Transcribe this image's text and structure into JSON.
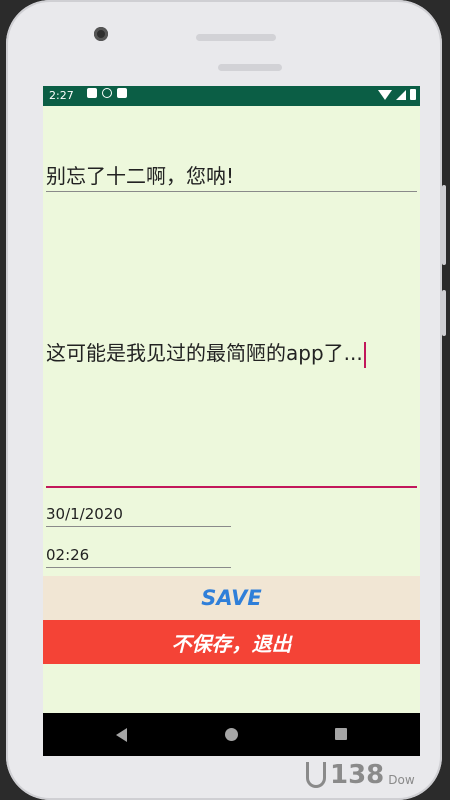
{
  "status_bar": {
    "time": "2:27",
    "left_icons": [
      "a-notification-icon",
      "sync-icon",
      "sd-card-icon"
    ],
    "right_icons": [
      "wifi-icon",
      "signal-icon",
      "battery-icon"
    ]
  },
  "note": {
    "title": "别忘了十二啊，您呐!",
    "content": "这可能是我见过的最简陋的app了...",
    "date": "30/1/2020",
    "time": "02:26"
  },
  "buttons": {
    "save_label": "SAVE",
    "exit_label": "不保存，退出"
  },
  "colors": {
    "screen_background": "#edf8dc",
    "status_bar": "#0b5e45",
    "save_background": "#f1e6d4",
    "save_text": "#2f7fd9",
    "exit_background": "#f44336",
    "accent_underline": "#c2185b"
  },
  "watermark": {
    "text": "138",
    "suffix": "Dow"
  }
}
